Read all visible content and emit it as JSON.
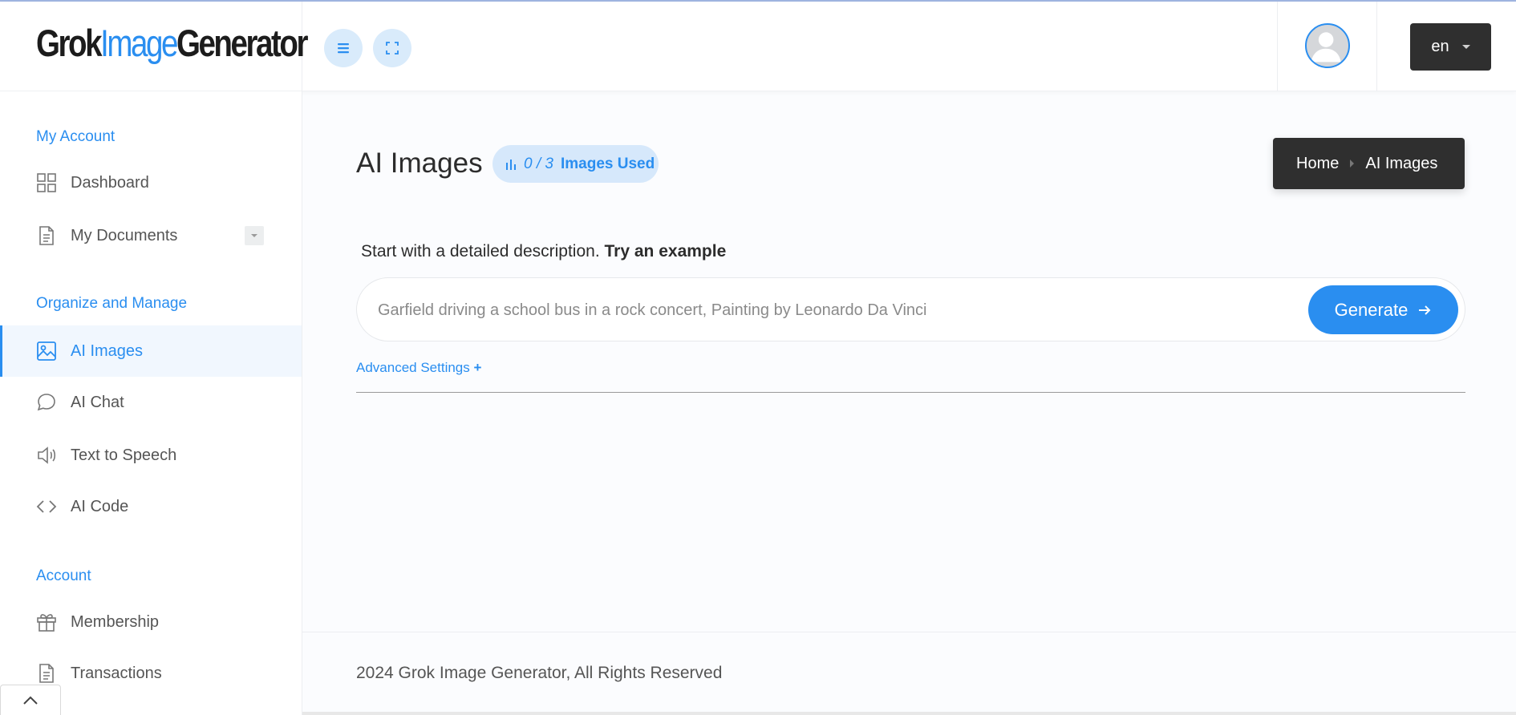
{
  "header": {
    "logo": {
      "part1": "Grok",
      "part2": "Image",
      "part3": "Generator"
    },
    "menu_icon": "menu-icon",
    "fullscreen_icon": "fullscreen-icon",
    "avatar_icon": "user-avatar-icon",
    "language": "en"
  },
  "sidebar": {
    "section_my_account": "My Account",
    "dashboard": "Dashboard",
    "my_documents": "My Documents",
    "section_organize": "Organize and Manage",
    "ai_images": "AI Images",
    "ai_chat": "AI Chat",
    "text_to_speech": "Text to Speech",
    "ai_code": "AI Code",
    "section_account": "Account",
    "membership": "Membership",
    "transactions": "Transactions"
  },
  "main": {
    "title": "AI Images",
    "usage": {
      "count": "0 / 3",
      "label": "Images Used"
    },
    "breadcrumb": {
      "home": "Home",
      "current": "AI Images"
    },
    "intro": "Start with a detailed description.",
    "try_example": "Try an example",
    "prompt_placeholder": "Garfield driving a school bus in a rock concert, Painting by Leonardo Da Vinci",
    "generate_label": "Generate",
    "advanced_label": "Advanced Settings",
    "advanced_plus": "+"
  },
  "footer": {
    "text": "2024 Grok Image Generator, All Rights Reserved"
  },
  "colors": {
    "accent": "#2a8ef0",
    "dark": "#2f2f2f",
    "badge_bg": "#d6e8fb"
  }
}
